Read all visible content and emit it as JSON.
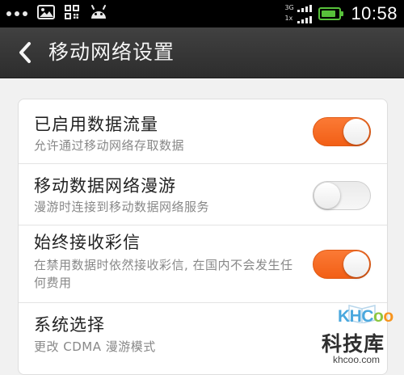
{
  "status_bar": {
    "net_top": "3G",
    "net_bottom": "1x",
    "time": "10:58",
    "battery_level_percent": 85,
    "battery_color": "#57c13a"
  },
  "header": {
    "title": "移动网络设置",
    "back_icon": "chevron-left-icon"
  },
  "settings": [
    {
      "title": "已启用数据流量",
      "subtitle": "允许通过移动网络存取数据",
      "toggle": true
    },
    {
      "title": "移动数据网络漫游",
      "subtitle": "漫游时连接到移动数据网络服务",
      "toggle": false
    },
    {
      "title": "始终接收彩信",
      "subtitle": "在禁用数据时依然接收彩信, 在国内不会发生任何费用",
      "toggle": true
    },
    {
      "title": "系统选择",
      "subtitle": "更改 CDMA 漫游模式"
    }
  ],
  "watermark": {
    "logo": "KHCoo",
    "name": "科技库",
    "url": "khcoo.com"
  },
  "colors": {
    "toggle_on": "#f2661c",
    "toggle_off": "#eeeeee",
    "header_bg": "#363636"
  }
}
